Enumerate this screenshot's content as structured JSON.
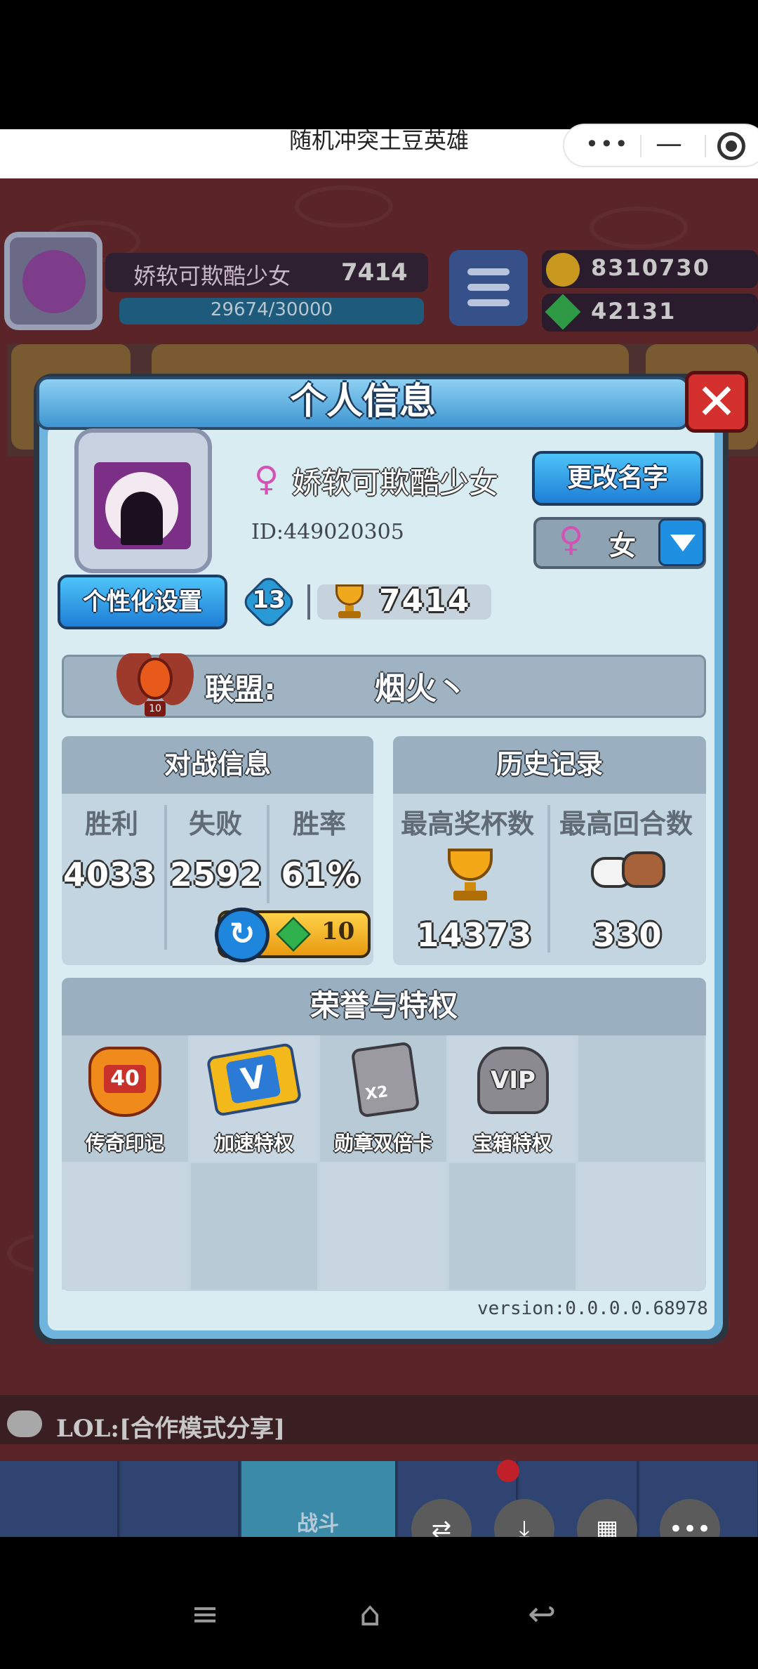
{
  "app": {
    "title": "随机冲突土豆英雄"
  },
  "hud": {
    "player_name": "娇软可欺酷少女",
    "trophies": "7414",
    "level": "13",
    "exp": "29674/30000",
    "coins": "8310730",
    "gems": "42131"
  },
  "chat": {
    "text": "LOL:[合作模式分享]"
  },
  "bottom_nav": {
    "battle_label": "战斗"
  },
  "modal": {
    "title": "个人信息",
    "close": "✕",
    "player_name": "娇软可欺酷少女",
    "player_id": "ID:449020305",
    "rename_button": "更改名字",
    "gender_value": "女",
    "personalize_button": "个性化设置",
    "level": "13",
    "trophies": "7414",
    "alliance_label": "联盟:",
    "alliance_name": "烟火丶",
    "alliance_level": "10",
    "battle": {
      "title": "对战信息",
      "headers": [
        "胜利",
        "失败",
        "胜率"
      ],
      "values": [
        "4033",
        "2592",
        "61%"
      ],
      "refresh_cost": "10"
    },
    "history": {
      "title": "历史记录",
      "headers": [
        "最高奖杯数",
        "最高回合数"
      ],
      "values": [
        "14373",
        "330"
      ]
    },
    "honor": {
      "title": "荣誉与特权",
      "items": [
        {
          "label": "传奇印记",
          "badge": "40",
          "icon": "legend-emblem-icon"
        },
        {
          "label": "加速特权",
          "badge": "V",
          "icon": "speed-ticket-icon"
        },
        {
          "label": "勋章双倍卡",
          "badge": "X2",
          "icon": "double-medal-card-icon"
        },
        {
          "label": "宝箱特权",
          "badge": "VIP",
          "icon": "vip-chest-icon"
        }
      ]
    },
    "version": "version:0.0.0.0.68978"
  },
  "colors": {
    "header_blue": "#3d95d0",
    "close_red": "#d3302e",
    "panel": "#c3d5e0",
    "gender_pink": "#d452b4"
  }
}
